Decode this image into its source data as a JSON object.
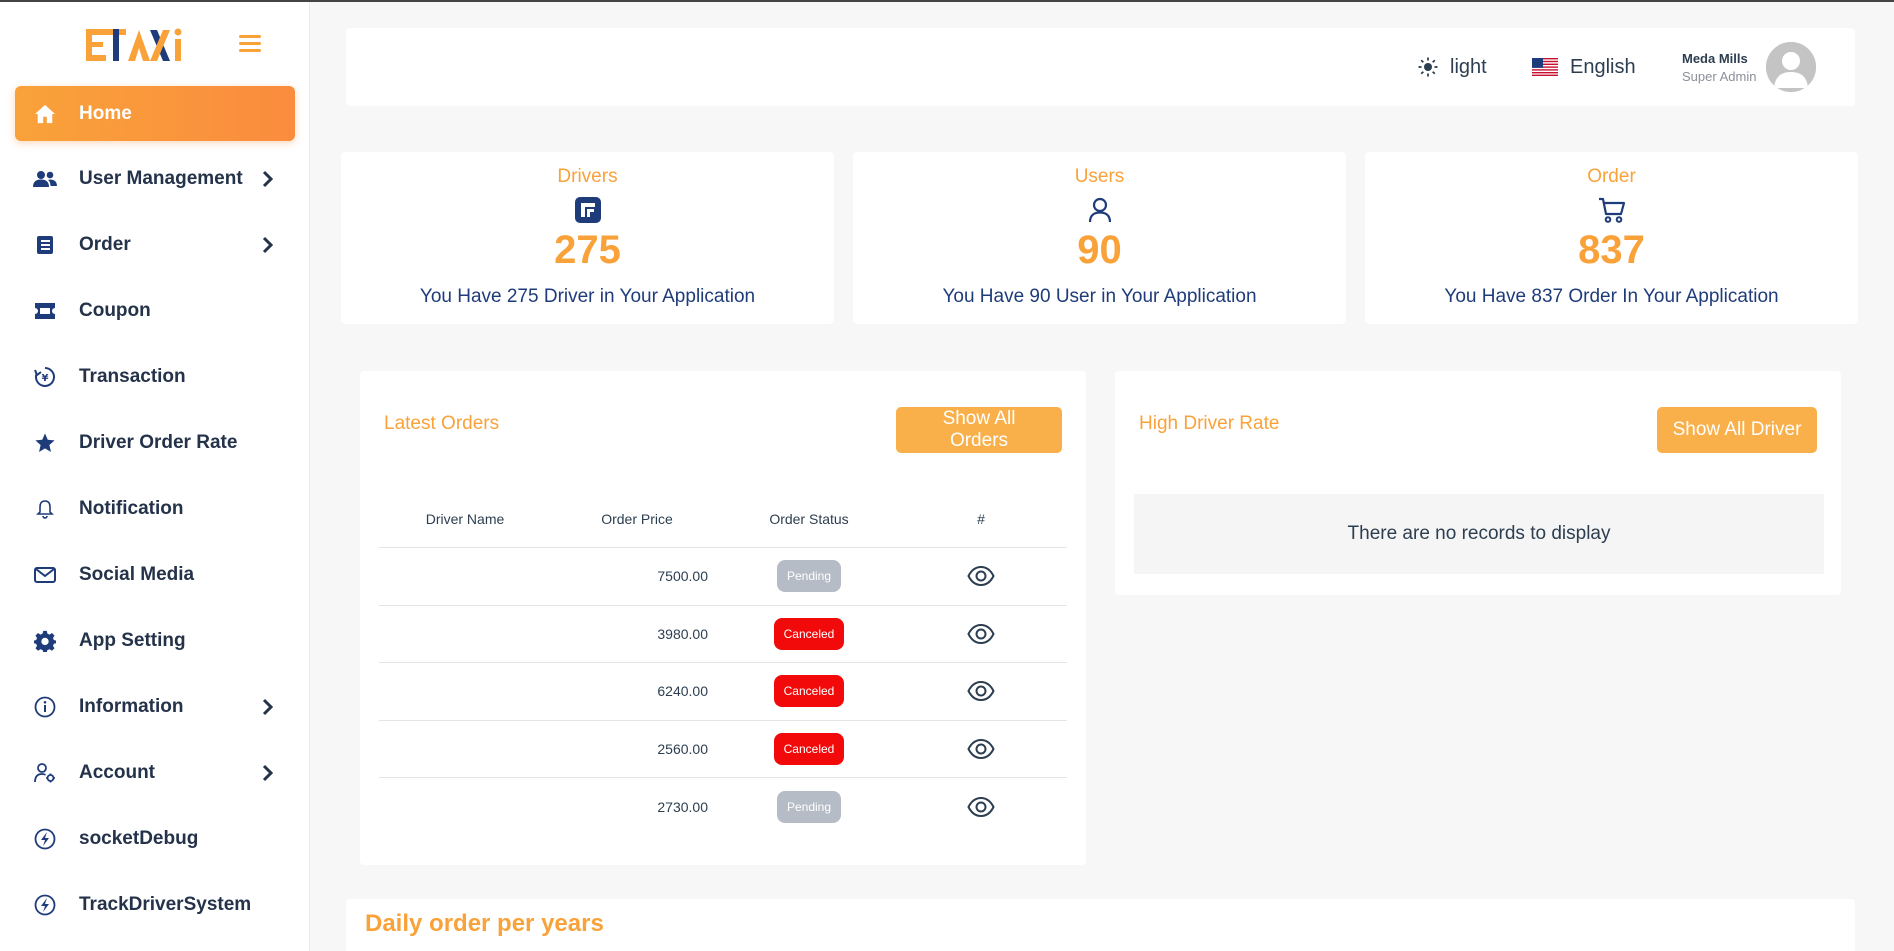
{
  "brand": {
    "logo_text": "ETAXI"
  },
  "sidebar": {
    "items": [
      {
        "label": "Home",
        "icon": "home-icon",
        "active": true,
        "has_submenu": false
      },
      {
        "label": "User Management",
        "icon": "users-icon",
        "active": false,
        "has_submenu": true
      },
      {
        "label": "Order",
        "icon": "order-list-icon",
        "active": false,
        "has_submenu": true
      },
      {
        "label": "Coupon",
        "icon": "ticket-icon",
        "active": false,
        "has_submenu": false
      },
      {
        "label": "Transaction",
        "icon": "currency-exchange-icon",
        "active": false,
        "has_submenu": false
      },
      {
        "label": "Driver Order Rate",
        "icon": "star-icon",
        "active": false,
        "has_submenu": false
      },
      {
        "label": "Notification",
        "icon": "bell-icon",
        "active": false,
        "has_submenu": false
      },
      {
        "label": "Social Media",
        "icon": "envelope-icon",
        "active": false,
        "has_submenu": false
      },
      {
        "label": "App Setting",
        "icon": "gear-icon",
        "active": false,
        "has_submenu": false
      },
      {
        "label": "Information",
        "icon": "info-circle-icon",
        "active": false,
        "has_submenu": true
      },
      {
        "label": "Account",
        "icon": "user-gear-icon",
        "active": false,
        "has_submenu": true
      },
      {
        "label": "socketDebug",
        "icon": "lightning-icon",
        "active": false,
        "has_submenu": false
      },
      {
        "label": "TrackDriverSystem",
        "icon": "lightning-icon",
        "active": false,
        "has_submenu": false
      }
    ]
  },
  "header": {
    "theme_label": "light",
    "language_label": "English",
    "user_name": "Meda Mills",
    "user_role": "Super Admin"
  },
  "stats": [
    {
      "title": "Drivers",
      "value": "275",
      "description": "You Have 275 Driver in Your Application",
      "icon": "driver-logo-icon"
    },
    {
      "title": "Users",
      "value": "90",
      "description": "You Have 90 User in Your Application",
      "icon": "user-icon"
    },
    {
      "title": "Order",
      "value": "837",
      "description": "You Have 837 Order In Your Application",
      "icon": "cart-icon"
    }
  ],
  "latest_orders": {
    "title": "Latest Orders",
    "button_label": "Show All Orders",
    "columns": [
      "Driver Name",
      "Order Price",
      "Order Status",
      "#"
    ],
    "rows": [
      {
        "driver": "",
        "price": "7500.00",
        "status": "Pending"
      },
      {
        "driver": "",
        "price": "3980.00",
        "status": "Canceled"
      },
      {
        "driver": "",
        "price": "6240.00",
        "status": "Canceled"
      },
      {
        "driver": "",
        "price": "2560.00",
        "status": "Canceled"
      },
      {
        "driver": "",
        "price": "2730.00",
        "status": "Pending"
      }
    ]
  },
  "high_driver_rate": {
    "title": "High Driver Rate",
    "button_label": "Show All Driver",
    "empty_text": "There are no records to display"
  },
  "daily_orders": {
    "title": "Daily order per years"
  },
  "colors": {
    "accent": "#f9a23a",
    "navy": "#1f3c7a",
    "canceled": "#f20a0a",
    "pending": "#b6bcc6"
  }
}
